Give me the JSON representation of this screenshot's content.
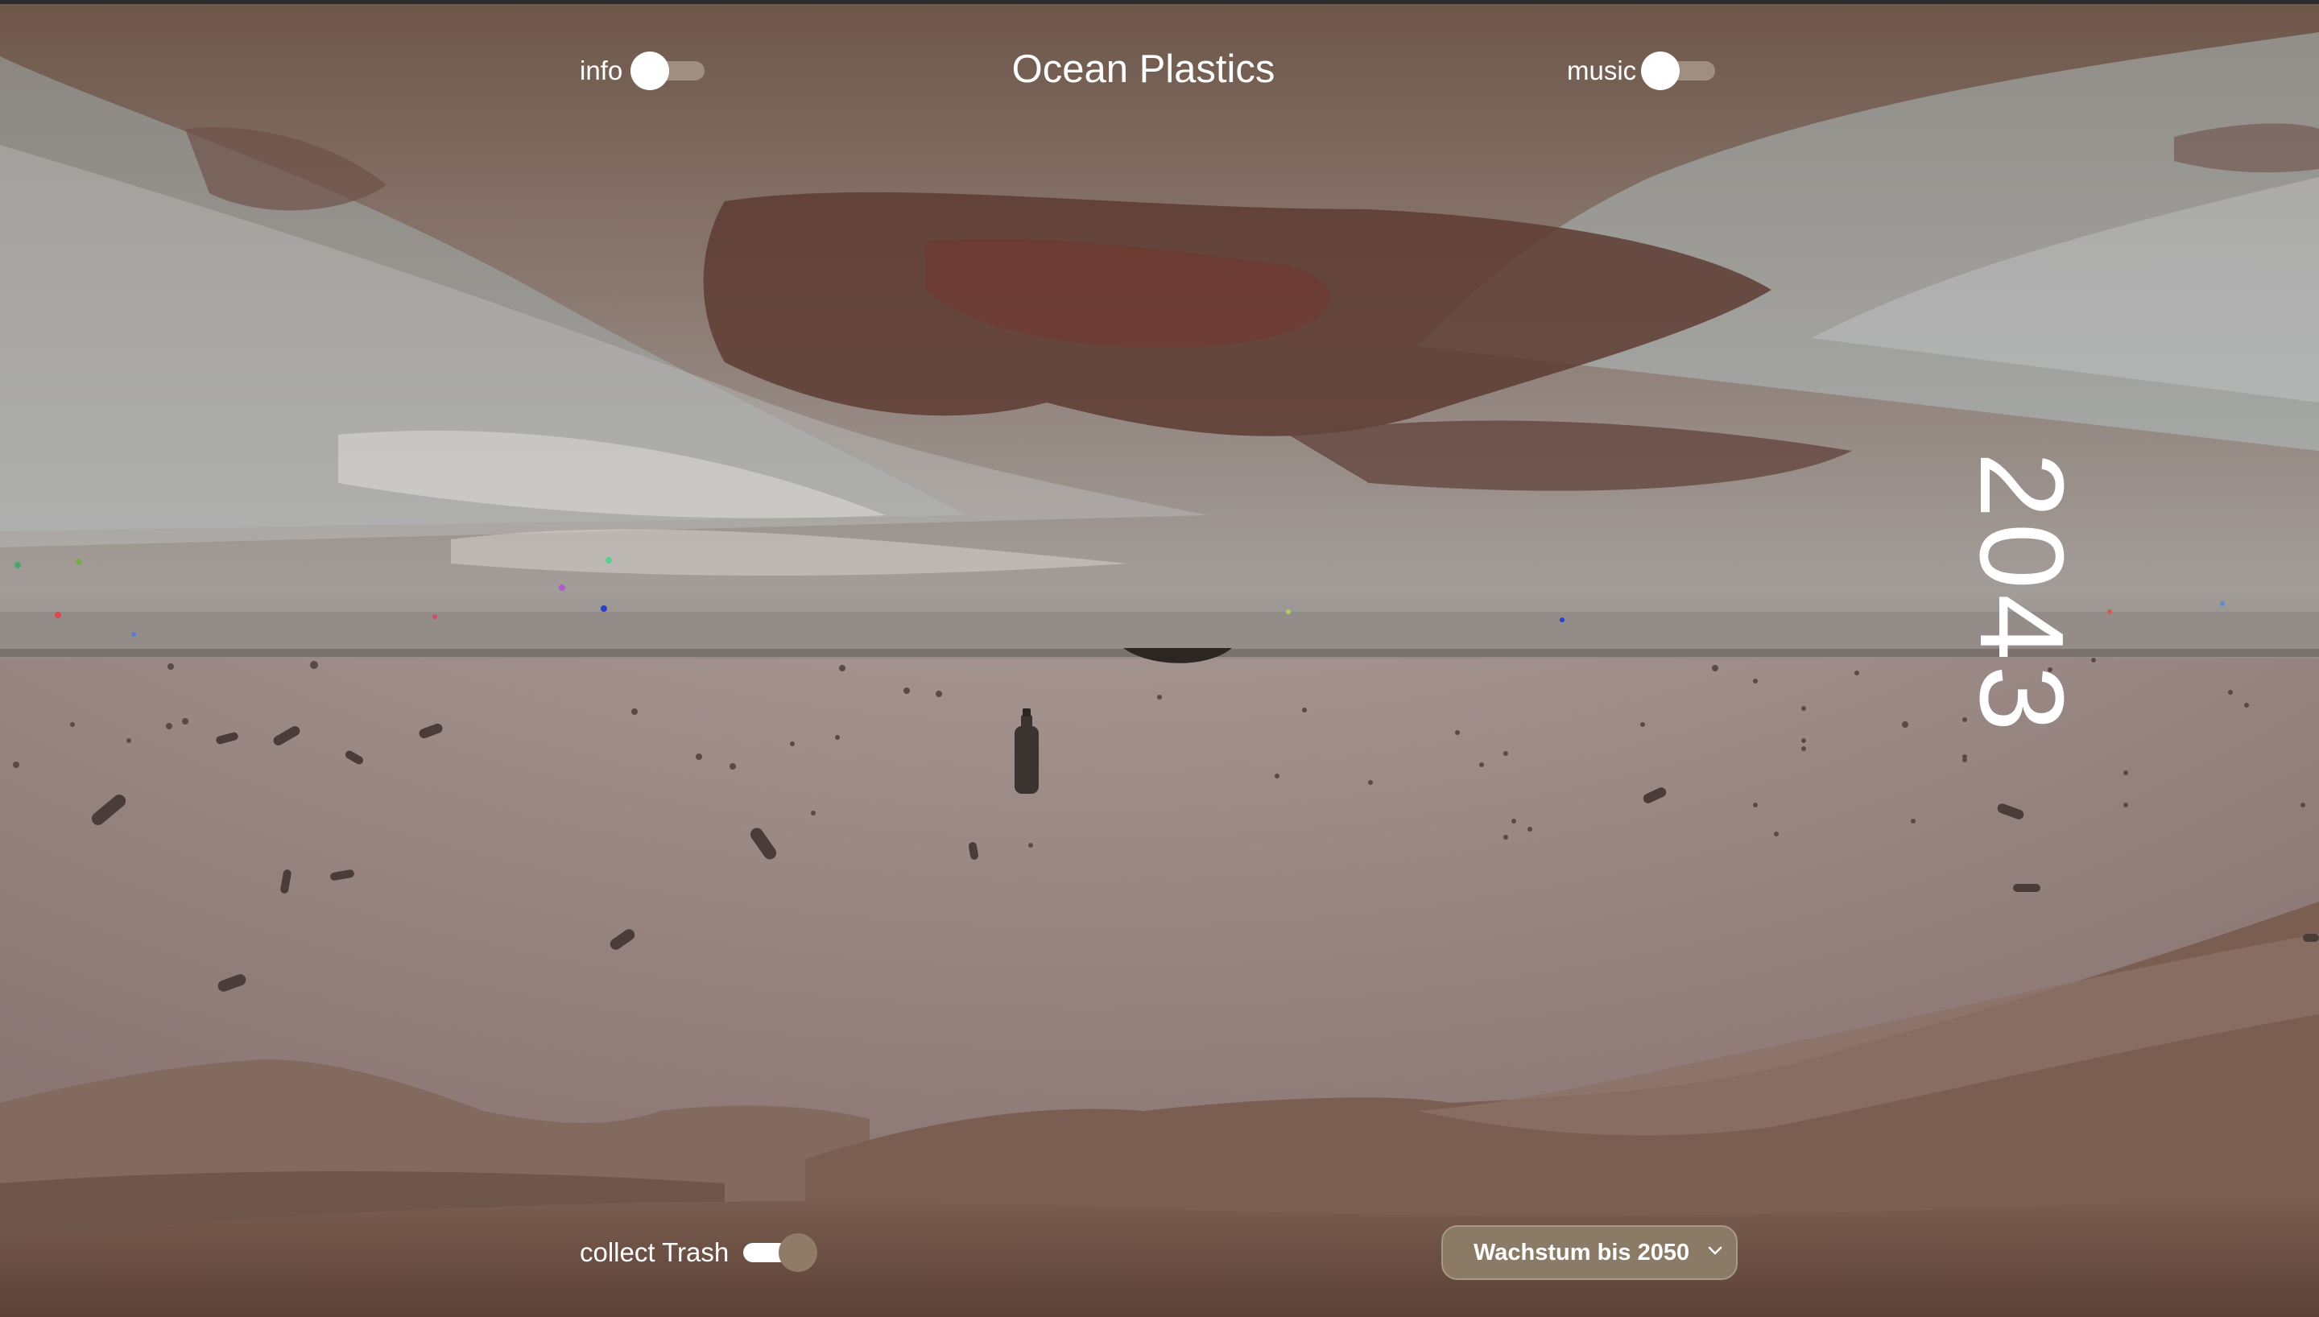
{
  "header": {
    "title": "Ocean Plastics",
    "info_label": "info",
    "music_label": "music"
  },
  "toggles": {
    "info": false,
    "music": false,
    "collect_trash": true
  },
  "footer": {
    "collect_trash_label": "collect Trash",
    "select_value": "Wachstum bis 2050"
  },
  "year_label": "2043",
  "icons": [
    "chevron-down-icon",
    "plastic-bottle",
    "floating-trash"
  ],
  "colors": {
    "sky_brown": "#6b5248",
    "surface_gray": "#9b948f",
    "water": "#a3938f",
    "ridge": "#7e6457",
    "select_bg": "#8a7a66"
  }
}
